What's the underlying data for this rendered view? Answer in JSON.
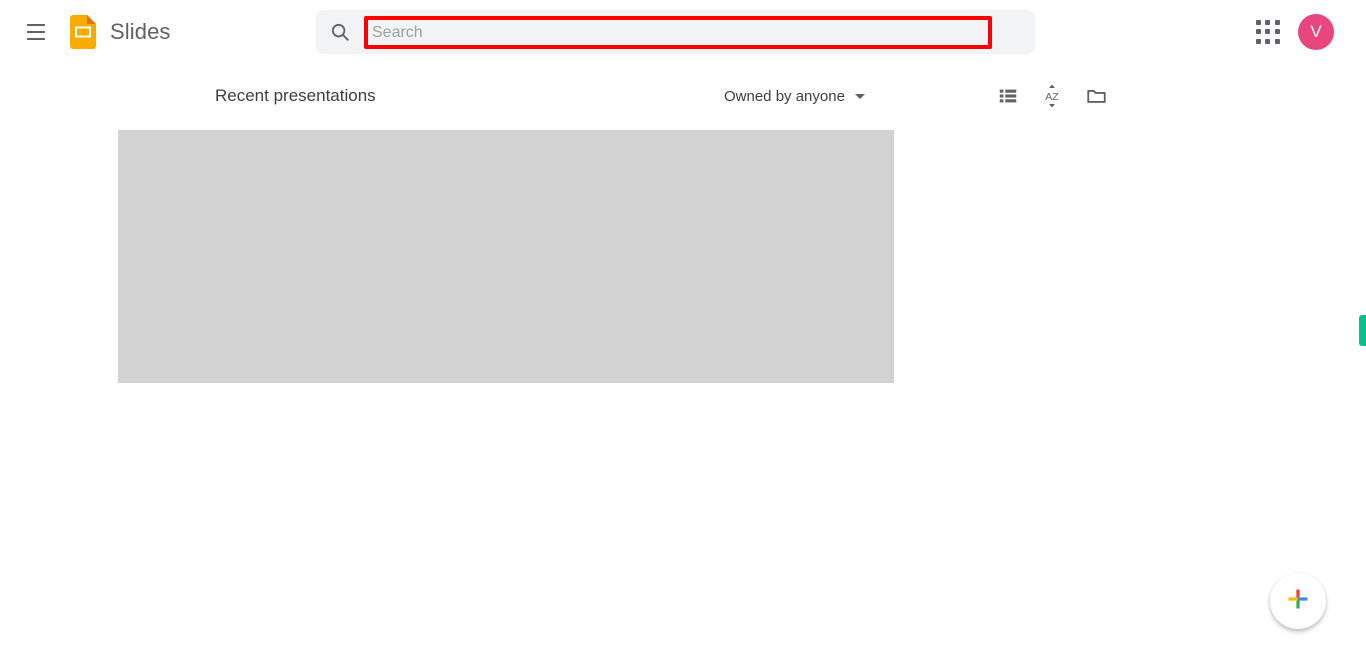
{
  "app": {
    "title": "Slides",
    "logo_icon": "slides-logo-icon",
    "menu_icon": "hamburger-menu-icon",
    "brand_color": "#F9AB00"
  },
  "search": {
    "icon": "search-icon",
    "placeholder": "Search",
    "value": "",
    "highlight_color": "#FF0000",
    "container_color": "#F1F3F4"
  },
  "account": {
    "apps_icon": "apps-grid-icon",
    "avatar_initial": "V",
    "avatar_color": "#E8467C"
  },
  "section": {
    "title": "Recent presentations",
    "owner_filter": {
      "label": "Owned by anyone",
      "caret_icon": "chevron-down-icon"
    },
    "actions": [
      {
        "name": "list-view-icon",
        "label": "List view"
      },
      {
        "name": "sort-az-icon",
        "label": "AZ"
      },
      {
        "name": "folder-icon",
        "label": "File picker"
      }
    ]
  },
  "content": {
    "placeholder_color": "#D2D2D2"
  },
  "edge_tab": {
    "name": "feedback-tab",
    "color": "#00C48C"
  },
  "fab": {
    "name": "new-presentation-fab",
    "icon": "google-plus-icon",
    "colors": {
      "top": "#EA4335",
      "right": "#4285F4",
      "bottom": "#34A853",
      "left": "#FBBC04"
    }
  }
}
